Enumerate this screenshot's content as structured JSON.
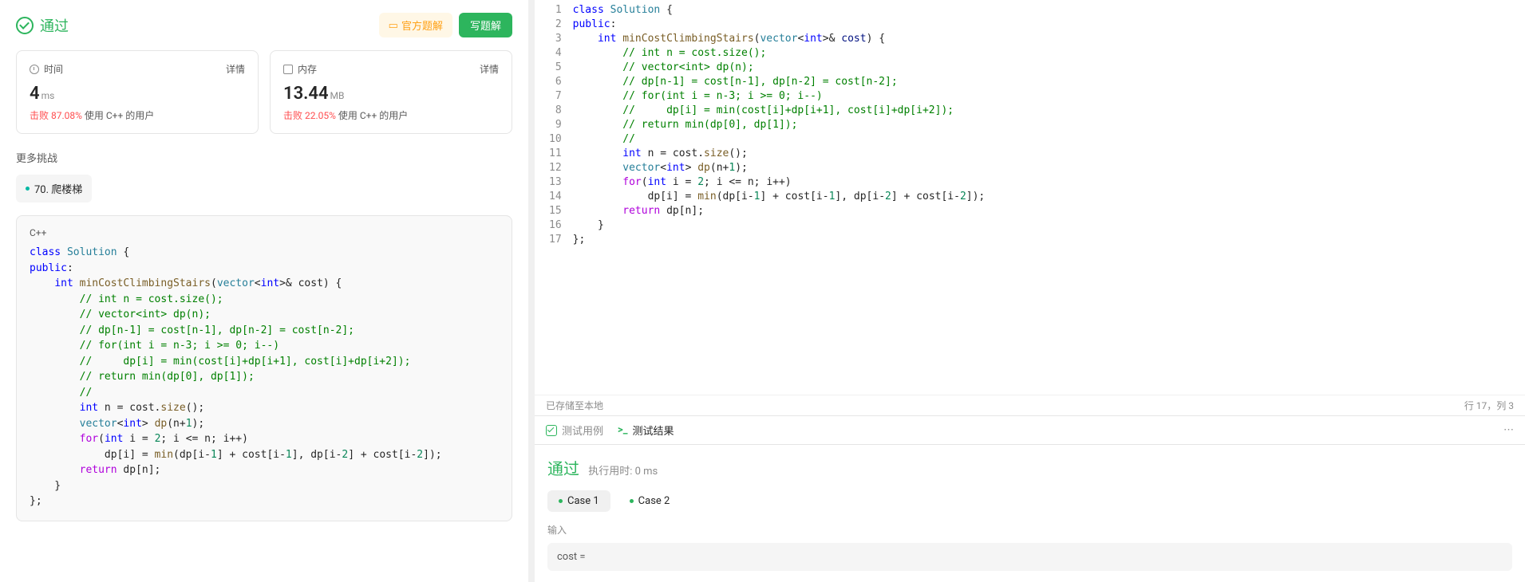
{
  "result": {
    "status": "通过",
    "official_solution_btn": "官方题解",
    "write_solution_btn": "写题解"
  },
  "stats": {
    "time": {
      "label": "时间",
      "detail": "详情",
      "value": "4",
      "unit": "ms",
      "beats_prefix": "击败 ",
      "beats_pct": "87.08%",
      "beats_suffix": " 使用 C++ 的用户"
    },
    "memory": {
      "label": "内存",
      "detail": "详情",
      "value": "13.44",
      "unit": "MB",
      "beats_prefix": "击败 ",
      "beats_pct": "22.05%",
      "beats_suffix": " 使用 C++ 的用户"
    }
  },
  "more_challenges": {
    "title": "更多挑战",
    "items": [
      {
        "label": "70. 爬楼梯"
      }
    ]
  },
  "code_preview": {
    "lang": "C++",
    "lines": [
      [
        {
          "c": "k-class",
          "t": "class"
        },
        {
          "c": "",
          "t": " "
        },
        {
          "c": "k-type",
          "t": "Solution"
        },
        {
          "c": "",
          "t": " {"
        }
      ],
      [
        {
          "c": "k-class",
          "t": "public"
        },
        {
          "c": "",
          "t": ":"
        }
      ],
      [
        {
          "c": "",
          "t": "    "
        },
        {
          "c": "k-class",
          "t": "int"
        },
        {
          "c": "",
          "t": " "
        },
        {
          "c": "k-fn",
          "t": "minCostClimbingStairs"
        },
        {
          "c": "",
          "t": "("
        },
        {
          "c": "k-type",
          "t": "vector"
        },
        {
          "c": "",
          "t": "<"
        },
        {
          "c": "k-class",
          "t": "int"
        },
        {
          "c": "",
          "t": ">& cost) {"
        }
      ],
      [
        {
          "c": "",
          "t": "        "
        },
        {
          "c": "k-cmt",
          "t": "// int n = cost.size();"
        }
      ],
      [
        {
          "c": "",
          "t": "        "
        },
        {
          "c": "k-cmt",
          "t": "// vector<int> dp(n);"
        }
      ],
      [
        {
          "c": "",
          "t": "        "
        },
        {
          "c": "k-cmt",
          "t": "// dp[n-1] = cost[n-1], dp[n-2] = cost[n-2];"
        }
      ],
      [
        {
          "c": "",
          "t": "        "
        },
        {
          "c": "k-cmt",
          "t": "// for(int i = n-3; i >= 0; i--)"
        }
      ],
      [
        {
          "c": "",
          "t": "        "
        },
        {
          "c": "k-cmt",
          "t": "//     dp[i] = min(cost[i]+dp[i+1], cost[i]+dp[i+2]);"
        }
      ],
      [
        {
          "c": "",
          "t": "        "
        },
        {
          "c": "k-cmt",
          "t": "// return min(dp[0], dp[1]);"
        }
      ],
      [
        {
          "c": "",
          "t": "        "
        },
        {
          "c": "k-cmt",
          "t": "//"
        }
      ],
      [
        {
          "c": "",
          "t": "        "
        },
        {
          "c": "k-class",
          "t": "int"
        },
        {
          "c": "",
          "t": " n = cost."
        },
        {
          "c": "k-fn",
          "t": "size"
        },
        {
          "c": "",
          "t": "();"
        }
      ],
      [
        {
          "c": "",
          "t": "        "
        },
        {
          "c": "k-type",
          "t": "vector"
        },
        {
          "c": "",
          "t": "<"
        },
        {
          "c": "k-class",
          "t": "int"
        },
        {
          "c": "",
          "t": "> "
        },
        {
          "c": "k-fn",
          "t": "dp"
        },
        {
          "c": "",
          "t": "(n+"
        },
        {
          "c": "k-num",
          "t": "1"
        },
        {
          "c": "",
          "t": ");"
        }
      ],
      [
        {
          "c": "",
          "t": "        "
        },
        {
          "c": "k-kw",
          "t": "for"
        },
        {
          "c": "",
          "t": "("
        },
        {
          "c": "k-class",
          "t": "int"
        },
        {
          "c": "",
          "t": " i = "
        },
        {
          "c": "k-num",
          "t": "2"
        },
        {
          "c": "",
          "t": "; i <= n; i++)"
        }
      ],
      [
        {
          "c": "",
          "t": "            dp[i] = "
        },
        {
          "c": "k-fn",
          "t": "min"
        },
        {
          "c": "",
          "t": "(dp[i-"
        },
        {
          "c": "k-num",
          "t": "1"
        },
        {
          "c": "",
          "t": "] + cost[i-"
        },
        {
          "c": "k-num",
          "t": "1"
        },
        {
          "c": "",
          "t": "], dp[i-"
        },
        {
          "c": "k-num",
          "t": "2"
        },
        {
          "c": "",
          "t": "] + cost[i-"
        },
        {
          "c": "k-num",
          "t": "2"
        },
        {
          "c": "",
          "t": "]);"
        }
      ],
      [
        {
          "c": "",
          "t": "        "
        },
        {
          "c": "k-kw",
          "t": "return"
        },
        {
          "c": "",
          "t": " dp[n];"
        }
      ],
      [
        {
          "c": "",
          "t": "    }"
        }
      ],
      [
        {
          "c": "",
          "t": "};"
        }
      ]
    ]
  },
  "editor": {
    "lines": [
      [
        {
          "c": "k-class",
          "t": "class"
        },
        {
          "c": "",
          "t": " "
        },
        {
          "c": "k-type",
          "t": "Solution"
        },
        {
          "c": "",
          "t": " {"
        }
      ],
      [
        {
          "c": "k-class",
          "t": "public"
        },
        {
          "c": "",
          "t": ":"
        }
      ],
      [
        {
          "c": "",
          "t": "    "
        },
        {
          "c": "k-class",
          "t": "int"
        },
        {
          "c": "",
          "t": " "
        },
        {
          "c": "k-fn",
          "t": "minCostClimbingStairs"
        },
        {
          "c": "",
          "t": "("
        },
        {
          "c": "k-type",
          "t": "vector"
        },
        {
          "c": "",
          "t": "<"
        },
        {
          "c": "k-class",
          "t": "int"
        },
        {
          "c": "",
          "t": ">& "
        },
        {
          "c": "k-var",
          "t": "cost"
        },
        {
          "c": "",
          "t": ") {"
        }
      ],
      [
        {
          "c": "",
          "t": "        "
        },
        {
          "c": "k-cmt",
          "t": "// int n = cost.size();"
        }
      ],
      [
        {
          "c": "",
          "t": "        "
        },
        {
          "c": "k-cmt",
          "t": "// vector<int> dp(n);"
        }
      ],
      [
        {
          "c": "",
          "t": "        "
        },
        {
          "c": "k-cmt",
          "t": "// dp[n-1] = cost[n-1], dp[n-2] = cost[n-2];"
        }
      ],
      [
        {
          "c": "",
          "t": "        "
        },
        {
          "c": "k-cmt",
          "t": "// for(int i = n-3; i >= 0; i--)"
        }
      ],
      [
        {
          "c": "",
          "t": "        "
        },
        {
          "c": "k-cmt",
          "t": "//     dp[i] = min(cost[i]+dp[i+1], cost[i]+dp[i+2]);"
        }
      ],
      [
        {
          "c": "",
          "t": "        "
        },
        {
          "c": "k-cmt",
          "t": "// return min(dp[0], dp[1]);"
        }
      ],
      [
        {
          "c": "",
          "t": "        "
        },
        {
          "c": "k-cmt",
          "t": "//"
        }
      ],
      [
        {
          "c": "",
          "t": "        "
        },
        {
          "c": "k-class",
          "t": "int"
        },
        {
          "c": "",
          "t": " n = cost."
        },
        {
          "c": "k-fn",
          "t": "size"
        },
        {
          "c": "",
          "t": "();"
        }
      ],
      [
        {
          "c": "",
          "t": "        "
        },
        {
          "c": "k-type",
          "t": "vector"
        },
        {
          "c": "",
          "t": "<"
        },
        {
          "c": "k-class",
          "t": "int"
        },
        {
          "c": "",
          "t": "> "
        },
        {
          "c": "k-fn",
          "t": "dp"
        },
        {
          "c": "",
          "t": "(n+"
        },
        {
          "c": "k-num",
          "t": "1"
        },
        {
          "c": "",
          "t": ");"
        }
      ],
      [
        {
          "c": "",
          "t": "        "
        },
        {
          "c": "k-kw",
          "t": "for"
        },
        {
          "c": "",
          "t": "("
        },
        {
          "c": "k-class",
          "t": "int"
        },
        {
          "c": "",
          "t": " i = "
        },
        {
          "c": "k-num",
          "t": "2"
        },
        {
          "c": "",
          "t": "; i <= n; i++)"
        }
      ],
      [
        {
          "c": "",
          "t": "            dp[i] = "
        },
        {
          "c": "k-fn",
          "t": "min"
        },
        {
          "c": "",
          "t": "(dp[i-"
        },
        {
          "c": "k-num",
          "t": "1"
        },
        {
          "c": "",
          "t": "] + cost[i-"
        },
        {
          "c": "k-num",
          "t": "1"
        },
        {
          "c": "",
          "t": "], dp[i-"
        },
        {
          "c": "k-num",
          "t": "2"
        },
        {
          "c": "",
          "t": "] + cost[i-"
        },
        {
          "c": "k-num",
          "t": "2"
        },
        {
          "c": "",
          "t": "]);"
        }
      ],
      [
        {
          "c": "",
          "t": "        "
        },
        {
          "c": "k-kw",
          "t": "return"
        },
        {
          "c": "",
          "t": " dp[n];"
        }
      ],
      [
        {
          "c": "",
          "t": "    }"
        }
      ],
      [
        {
          "c": "",
          "t": "};"
        }
      ]
    ],
    "saved_text": "已存储至本地",
    "cursor_text": "行 17，列 3"
  },
  "test_panel": {
    "tab_cases": "测试用例",
    "tab_results": "测试结果",
    "pass_text": "通过",
    "runtime_text": "执行用时: 0 ms",
    "case1": "Case 1",
    "case2": "Case 2",
    "input_label": "输入",
    "cost_label": "cost ="
  }
}
